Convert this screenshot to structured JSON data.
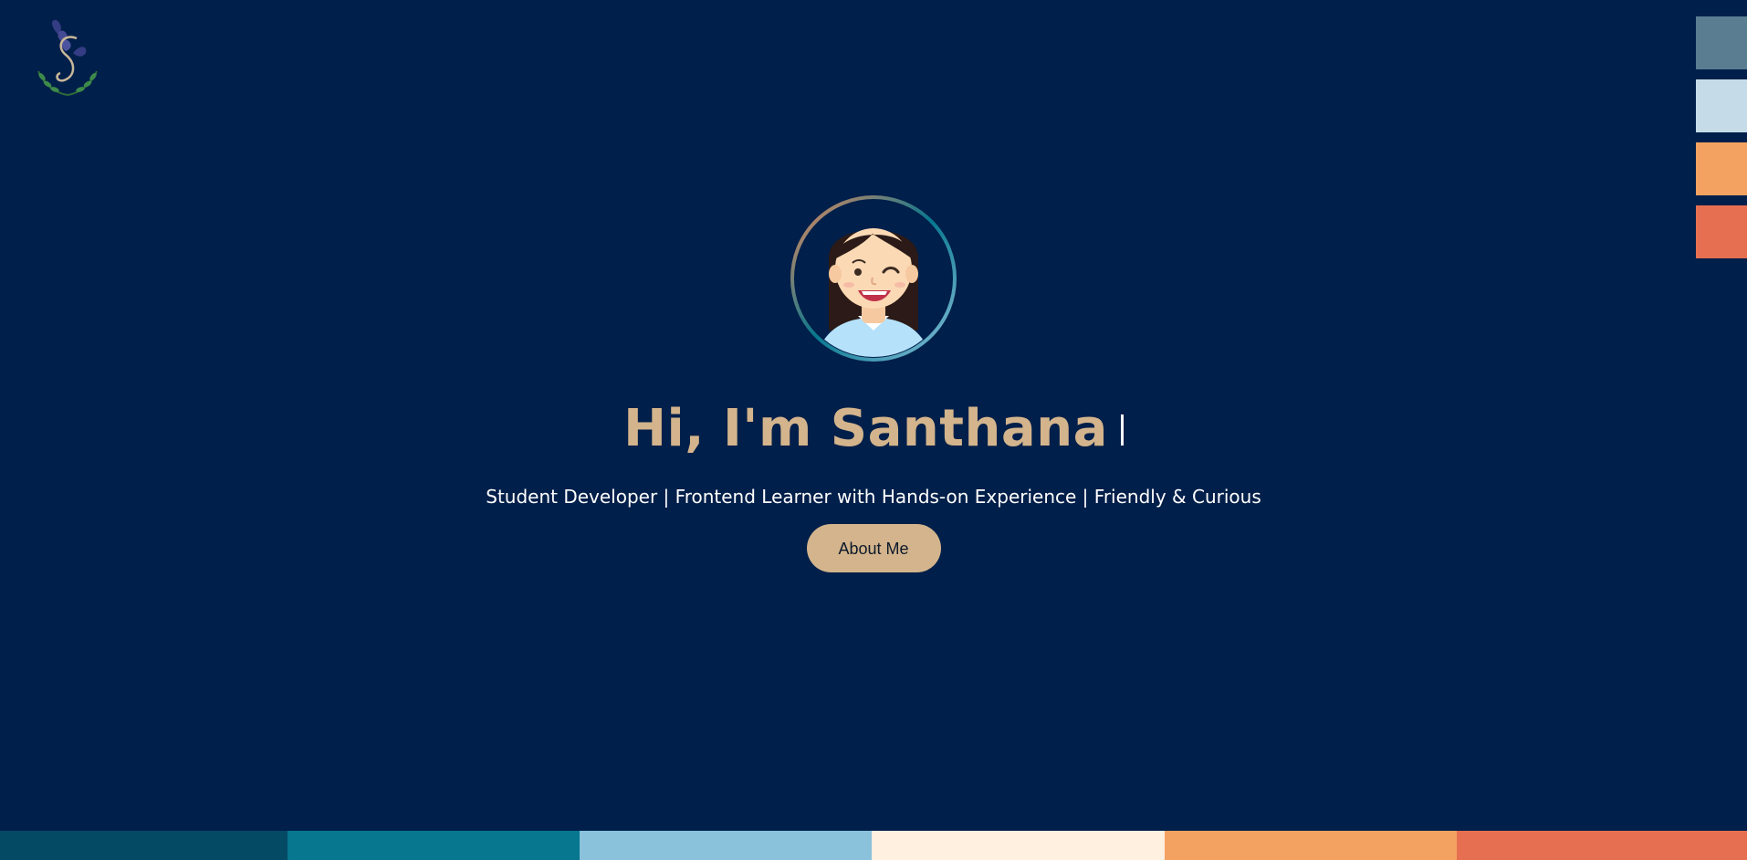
{
  "hero": {
    "title": "Hi, I'm Santhana",
    "tagline": "Student Developer | Frontend Learner with Hands-on Experience | Friendly & Curious",
    "button_label": "About Me"
  },
  "icons": {
    "logo": "logo-icon",
    "avatar": "avatar-icon"
  },
  "colors": {
    "background": "#001f4a",
    "accent": "#d3b48c",
    "text": "#ffffff"
  },
  "theme_swatches": [
    {
      "name": "slate-blue",
      "color": "#5a7d92"
    },
    {
      "name": "light-blue",
      "color": "#c5dbe8"
    },
    {
      "name": "orange",
      "color": "#f3a261"
    },
    {
      "name": "coral",
      "color": "#e76f51"
    }
  ],
  "footer_palette": [
    "#054a65",
    "#06778f",
    "#8ac1db",
    "#fff0e0",
    "#f3a261",
    "#e76f51"
  ]
}
